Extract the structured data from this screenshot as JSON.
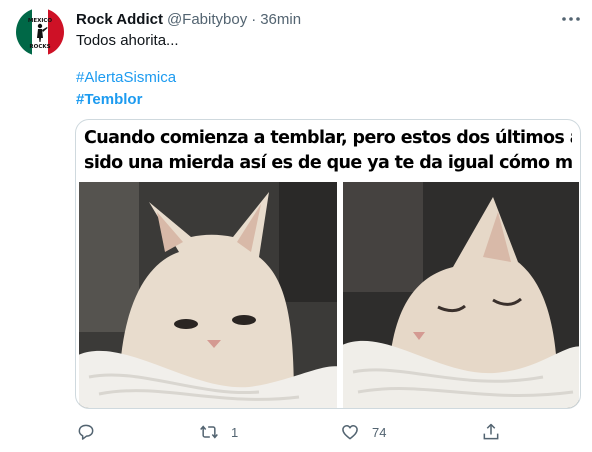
{
  "tweet": {
    "display_name": "Rock Addict",
    "handle": "@Fabityboy",
    "separator": "·",
    "time": "36min",
    "text": "Todos ahorita...",
    "hashtags": [
      "#AlertaSismica",
      "#Temblor"
    ]
  },
  "avatar": {
    "text_top": "MEXICO",
    "text_bottom": "ROCKS",
    "colors": [
      "#006847",
      "#ffffff",
      "#ce1126"
    ]
  },
  "media": {
    "caption_lines": [
      "Cuando comienza a temblar, pero estos dos últimos años han",
      "sido una mierda así es de que ya te da igual cómo morirás..."
    ]
  },
  "actions": {
    "reply_count": "",
    "retweet_count": "1",
    "like_count": "74",
    "icon_color": "#536471"
  },
  "icons": {
    "more": "more-icon",
    "reply": "reply-icon",
    "retweet": "retweet-icon",
    "like": "heart-icon",
    "share": "share-icon"
  }
}
